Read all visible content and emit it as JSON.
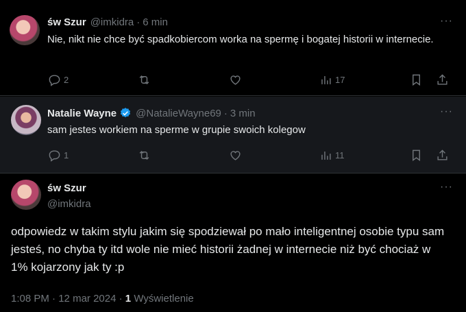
{
  "tweets": [
    {
      "name": "św Szur",
      "handle": "@imkidra",
      "time": "6 min",
      "text": "Nie, nikt nie chce być spadkobiercom worka na spermę i bogatej historii w internecie.",
      "replies": "2",
      "views": "17",
      "more": "···"
    },
    {
      "name": "Natalie Wayne",
      "handle": "@NatalieWayne69",
      "time": "3 min",
      "text": "sam jestes workiem na sperme w grupie swoich kolegow",
      "replies": "1",
      "views": "11",
      "more": "···"
    }
  ],
  "main_tweet": {
    "name": "św Szur",
    "handle": "@imkidra",
    "more": "···",
    "text": "odpowiedz w takim stylu jakim się spodziewał po mało inteligentnej osobie typu sam jesteś, no chyba ty itd wole nie mieć historii żadnej w internecie niż być chociaż w 1% kojarzony jak ty :p",
    "timestamp": "1:08 PM",
    "date": "12 mar 2024",
    "views_count": "1",
    "views_label": "Wyświetlenie"
  },
  "colors": {
    "verified": "#1d9bf0",
    "muted": "#71767b",
    "text": "#e7e9ea"
  }
}
